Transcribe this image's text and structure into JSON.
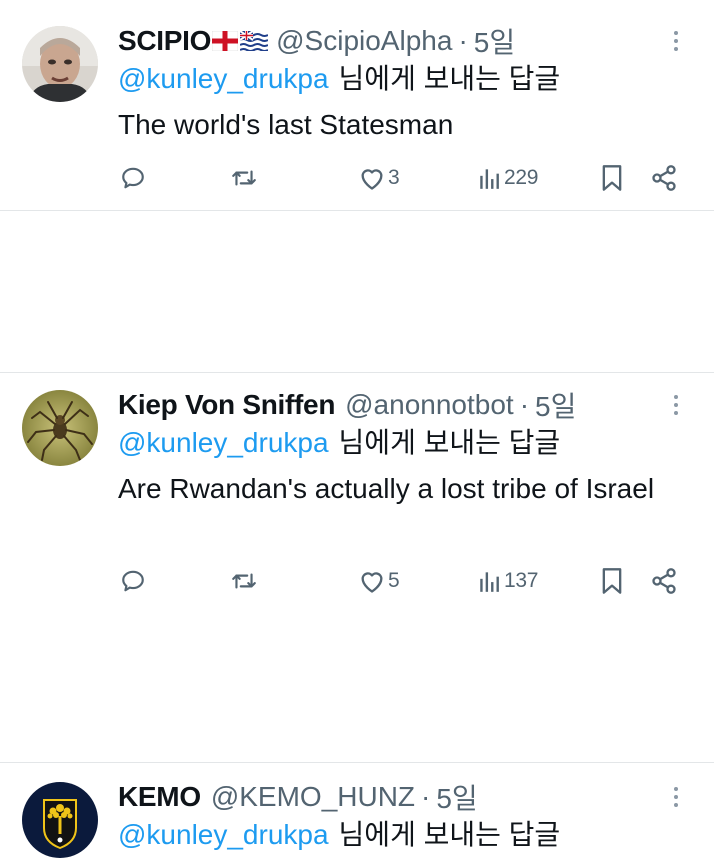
{
  "tweets": [
    {
      "name": "SCIPIO",
      "handle": "@ScipioAlpha",
      "separator": "·",
      "time": "5일",
      "mention": "@kunley_drukpa",
      "reply_suffix": "님에게 보내는 답글",
      "text": "The world's last Statesman",
      "likes": "3",
      "views": "229"
    },
    {
      "name": "Kiep Von Sniffen",
      "handle": "@anonnotbot",
      "separator": "·",
      "time": "5일",
      "mention": "@kunley_drukpa",
      "reply_suffix": "님에게 보내는 답글",
      "text": "Are Rwandan's actually a lost tribe of Israel",
      "likes": "5",
      "views": "137"
    },
    {
      "name": "KEMO",
      "handle": "@KEMO_HUNZ",
      "separator": "·",
      "time": "5일",
      "mention": "@kunley_drukpa",
      "reply_suffix": "님에게 보내는 답글"
    }
  ],
  "colors": {
    "mention_blue": "#1d9bf0",
    "secondary_gray": "#536471",
    "divider": "#e3e6e8"
  },
  "icons": [
    "reply-icon",
    "retweet-icon",
    "like-icon",
    "views-icon",
    "bookmark-icon",
    "share-icon",
    "more-options-icon",
    "england-flag-icon",
    "british-indian-ocean-flag-icon"
  ]
}
